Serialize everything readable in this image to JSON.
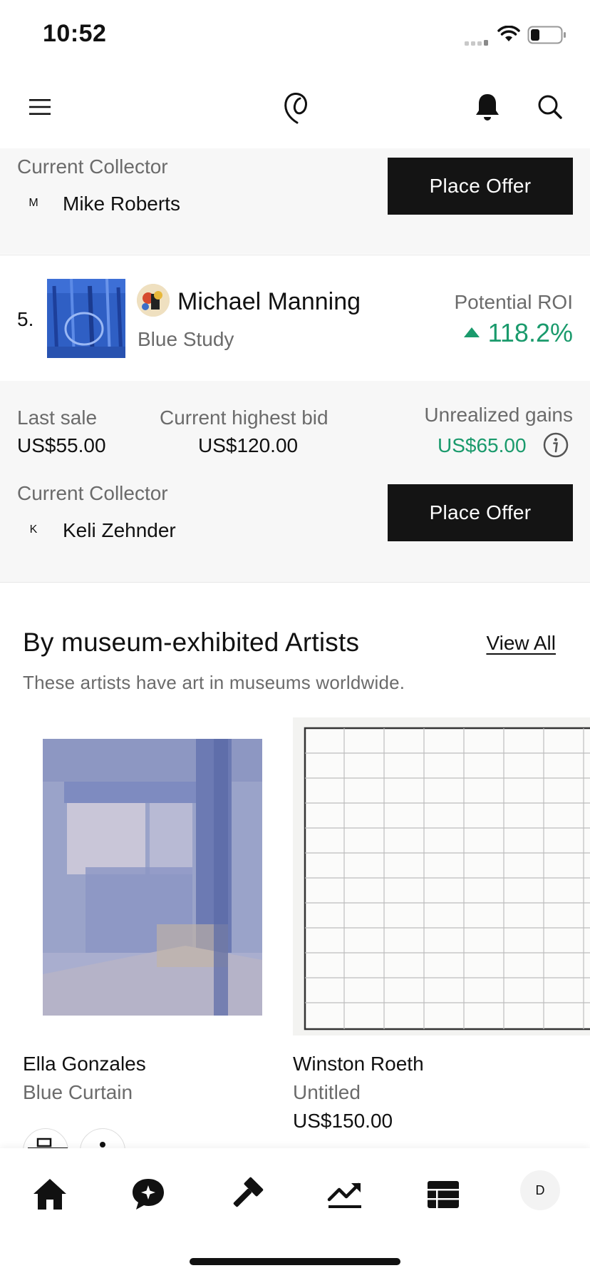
{
  "status_bar": {
    "time": "10:52"
  },
  "top_nav": {
    "icons": [
      "menu-icon",
      "logo-icon",
      "bell-icon",
      "search-icon"
    ]
  },
  "prev_item": {
    "collector_label": "Current Collector",
    "collector_initial": "M",
    "collector_name": "Mike Roberts",
    "offer_button": "Place Offer"
  },
  "item5": {
    "rank": "5.",
    "artist": "Michael Manning",
    "title": "Blue Study",
    "roi_label": "Potential ROI",
    "roi_value": "118.2%",
    "last_sale_label": "Last sale",
    "last_sale_value": "US$55.00",
    "highest_bid_label": "Current highest bid",
    "highest_bid_value": "US$120.00",
    "gains_label": "Unrealized gains",
    "gains_value": "US$65.00",
    "collector_label": "Current Collector",
    "collector_initial": "K",
    "collector_name": "Keli Zehnder",
    "offer_button": "Place Offer"
  },
  "museum_section": {
    "title": "By museum-exhibited Artists",
    "view_all": "View All",
    "subtitle": "These artists have art in museums worldwide.",
    "artworks": [
      {
        "artist": "Ella Gonzales",
        "title": "Blue Curtain",
        "price": ""
      },
      {
        "artist": "Winston Roeth",
        "title": "Untitled",
        "price": "US$150.00"
      }
    ]
  },
  "tab_bar": {
    "icons": [
      "home-icon",
      "chat-sparkle-icon",
      "gavel-icon",
      "trend-icon",
      "list-icon"
    ],
    "profile_initial": "D"
  },
  "colors": {
    "accent_green": "#1a9a6c",
    "button_black": "#141414",
    "section_gray": "#f7f7f7"
  }
}
